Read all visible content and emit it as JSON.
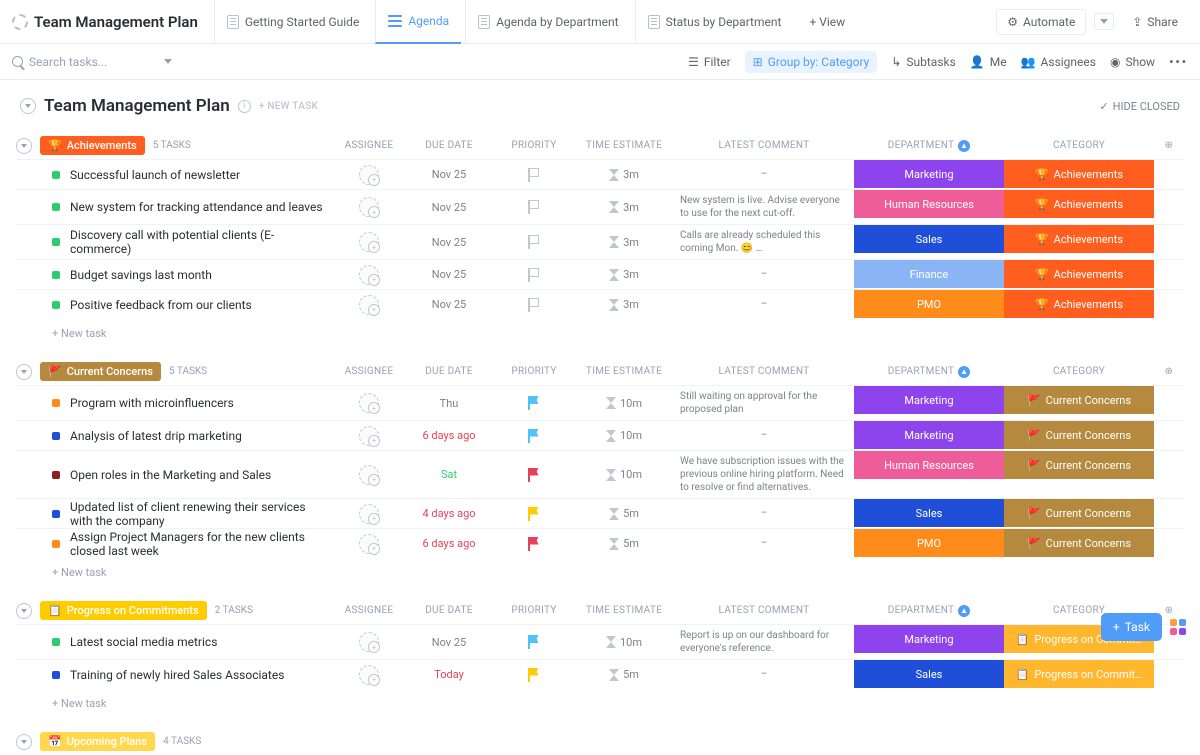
{
  "app_title": "Team Management Plan",
  "views": {
    "guide": "Getting Started Guide",
    "agenda": "Agenda",
    "by_dept": "Agenda by Department",
    "status_dept": "Status by Department",
    "add": "+  View"
  },
  "top_right": {
    "automate": "Automate",
    "share": "Share"
  },
  "toolbar": {
    "search_placeholder": "Search tasks...",
    "filter": "Filter",
    "groupby": "Group by: Category",
    "subtasks": "Subtasks",
    "me": "Me",
    "assignees": "Assignees",
    "show": "Show"
  },
  "main": {
    "title": "Team Management Plan",
    "newtask": "+ NEW TASK",
    "hide_closed": "HIDE CLOSED"
  },
  "cols": {
    "assignee": "ASSIGNEE",
    "due": "DUE DATE",
    "priority": "PRIORITY",
    "est": "TIME ESTIMATE",
    "comment": "LATEST COMMENT",
    "dept": "DEPARTMENT",
    "cat": "CATEGORY"
  },
  "depts": {
    "marketing": {
      "label": "Marketing",
      "bg": "#8e44ec"
    },
    "hr": {
      "label": "Human Resources",
      "bg": "#ee5d99"
    },
    "sales": {
      "label": "Sales",
      "bg": "#1f4fd8"
    },
    "finance": {
      "label": "Finance",
      "bg": "#8ab5f5"
    },
    "pmo": {
      "label": "PMO",
      "bg": "#ff8c1a"
    }
  },
  "groups": [
    {
      "name": "Achievements",
      "count": "5 TASKS",
      "badge_bg": "#ff5e1f",
      "cat_bg": "#ff5e1f",
      "cat_label": "Achievements",
      "cat_emoji": "🏆",
      "flagcolor": "#c1c7d0",
      "flag_outline": true,
      "rows": [
        {
          "sq": "#2ecc71",
          "name": "Successful launch of newsletter",
          "due": "Nov 25",
          "duecolor": "#7c828d",
          "est": "3m",
          "comment": "–",
          "dept": "marketing"
        },
        {
          "sq": "#2ecc71",
          "name": "New system for tracking attendance and leaves",
          "due": "Nov 25",
          "duecolor": "#7c828d",
          "est": "3m",
          "comment": "New system is live. Advise everyone to use for the next cut-off.",
          "dept": "hr"
        },
        {
          "sq": "#2ecc71",
          "name": "Discovery call with potential clients (E-commerce)",
          "due": "Nov 25",
          "duecolor": "#7c828d",
          "est": "3m",
          "comment": "Calls are already scheduled this coming Mon. 😊 …",
          "dept": "sales"
        },
        {
          "sq": "#2ecc71",
          "name": "Budget savings last month",
          "due": "Nov 25",
          "duecolor": "#7c828d",
          "est": "3m",
          "comment": "–",
          "dept": "finance"
        },
        {
          "sq": "#2ecc71",
          "name": "Positive feedback from our clients",
          "due": "Nov 25",
          "duecolor": "#7c828d",
          "est": "3m",
          "comment": "–",
          "dept": "pmo"
        }
      ]
    },
    {
      "name": "Current Concerns",
      "count": "5 TASKS",
      "badge_bg": "#b58a3e",
      "cat_bg": "#b58a3e",
      "cat_label": "Current Concerns",
      "cat_emoji": "🚩",
      "rows": [
        {
          "sq": "#ff8c1a",
          "name": "Program with microinfluencers",
          "due": "Thu",
          "duecolor": "#7c828d",
          "est": "10m",
          "flagcolor": "#4fc3f7",
          "comment": "Still waiting on approval for the proposed plan",
          "dept": "marketing"
        },
        {
          "sq": "#1f4fd8",
          "name": "Analysis of latest drip marketing",
          "due": "6 days ago",
          "duecolor": "#e44258",
          "est": "10m",
          "flagcolor": "#4fc3f7",
          "comment": "–",
          "dept": "marketing"
        },
        {
          "sq": "#8a2020",
          "name": "Open roles in the Marketing and Sales",
          "due": "Sat",
          "duecolor": "#2ecc71",
          "est": "10m",
          "flagcolor": "#e44258",
          "comment": "We have subscription issues with the previous online hiring platform. Need to resolve or find alternatives.",
          "dept": "hr"
        },
        {
          "sq": "#1f4fd8",
          "name": "Updated list of client renewing their services with the company",
          "due": "4 days ago",
          "duecolor": "#e44258",
          "est": "5m",
          "flagcolor": "#ffcc00",
          "comment": "–",
          "dept": "sales"
        },
        {
          "sq": "#ff8c1a",
          "name": "Assign Project Managers for the new clients closed last week",
          "due": "6 days ago",
          "duecolor": "#e44258",
          "est": "5m",
          "flagcolor": "#e44258",
          "comment": "–",
          "dept": "pmo"
        }
      ]
    },
    {
      "name": "Progress on Commitments",
      "count": "2 TASKS",
      "badge_bg": "#ffcc00",
      "cat_bg": "#ffb82e",
      "cat_label": "Progress on Commit…",
      "cat_emoji": "📋",
      "rows": [
        {
          "sq": "#2ecc71",
          "name": "Latest social media metrics",
          "due": "Nov 25",
          "duecolor": "#7c828d",
          "est": "10m",
          "flagcolor": "#4fc3f7",
          "comment": "Report is up on our dashboard for everyone's reference.",
          "dept": "marketing"
        },
        {
          "sq": "#1f4fd8",
          "name": "Training of newly hired Sales Associates",
          "due": "Today",
          "duecolor": "#e44258",
          "est": "5m",
          "flagcolor": "#ffcc00",
          "comment": "–",
          "dept": "sales"
        }
      ]
    }
  ],
  "upcoming": {
    "name": "Upcoming Plans",
    "count": "4 TASKS",
    "badge_bg": "#ffd84d"
  },
  "newtask_row": "+ New task",
  "fab": "Task"
}
